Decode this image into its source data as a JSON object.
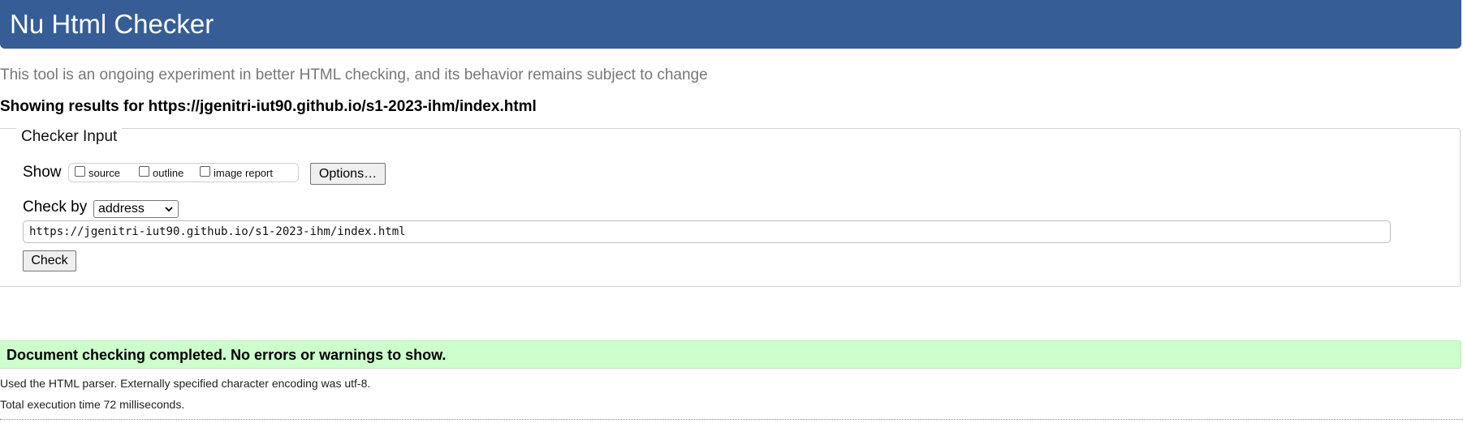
{
  "header": {
    "title": "Nu Html Checker"
  },
  "subtitle": "This tool is an ongoing experiment in better HTML checking, and its behavior remains subject to change",
  "results_for": "Showing results for https://jgenitri-iut90.github.io/s1-2023-ihm/index.html",
  "checker_input": {
    "legend": "Checker Input",
    "show_label": "Show",
    "options": [
      {
        "label": "source",
        "checked": false
      },
      {
        "label": "outline",
        "checked": false
      },
      {
        "label": "image report",
        "checked": false
      }
    ],
    "options_button": "Options…",
    "check_by_label": "Check by",
    "check_by_value": "address",
    "url_value": "https://jgenitri-iut90.github.io/s1-2023-ihm/index.html",
    "check_button": "Check"
  },
  "result": {
    "message": "Document checking completed. No errors or warnings to show.",
    "parser_info": "Used the HTML parser. Externally specified character encoding was utf-8.",
    "execution_time": "Total execution time 72 milliseconds."
  },
  "colors": {
    "header_bg": "#365d95",
    "success_bg": "#ccffcc"
  }
}
